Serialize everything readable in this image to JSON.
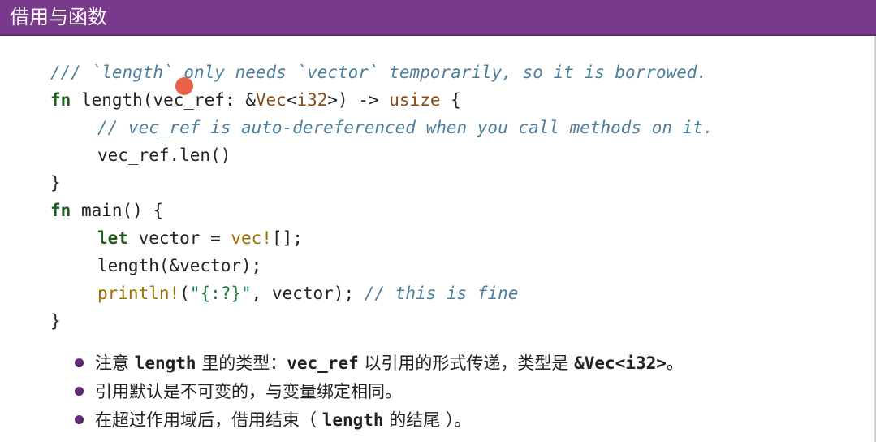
{
  "slide": {
    "title": "借用与函数"
  },
  "code": {
    "l1": "/// `length` only needs `vector` temporarily, so it is borrowed.",
    "l2_fn": "fn",
    "l2_name": " length(vec_ref: &",
    "l2_type": "Vec",
    "l2_lt": "<",
    "l2_i32": "i32",
    "l2_rest": ">) -> ",
    "l2_ret": "usize",
    "l2_brace": " {",
    "l3": "// vec_ref is auto-dereferenced when you call methods on it.",
    "l4": "vec_ref.len()",
    "l5": "}",
    "l6_fn": "fn",
    "l6_rest": " main() {",
    "l7_let": "let",
    "l7_mid": " vector = ",
    "l7_mac": "vec!",
    "l7_end": "[];",
    "l8": "length(&vector);",
    "l9_mac": "println!",
    "l9_open": "(",
    "l9_str": "\"{:?}\"",
    "l9_mid": ", vector); ",
    "l9_cmt": "// this is fine",
    "l10": "}"
  },
  "bullets": {
    "b1_a": "注意 ",
    "b1_code1": "length",
    "b1_b": " 里的类型：",
    "b1_code2": "vec_ref",
    "b1_c": " 以引用的形式传递，类型是 ",
    "b1_code3": "&Vec<i32>",
    "b1_d": "。",
    "b2": "引用默认是不可变的，与变量绑定相同。",
    "b3_a": "在超过作用域后，借用结束（ ",
    "b3_code": "length",
    "b3_b": " 的结尾 ）。"
  },
  "colors": {
    "title_bar": "#7a3a8c",
    "comment": "#4d7f9c",
    "keyword": "#1f5a1f",
    "type": "#8a4a14",
    "macro": "#a07000",
    "bullet": "#6b2d7d",
    "cursor": "#e8523a"
  }
}
